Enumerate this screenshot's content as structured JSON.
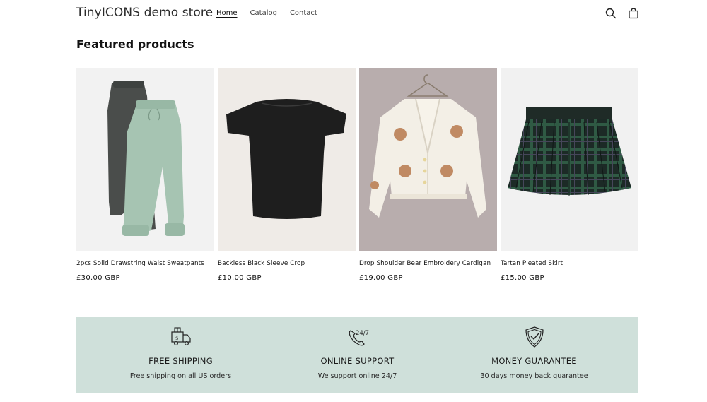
{
  "header": {
    "store_name": "TinyICONS demo store",
    "nav": [
      {
        "label": "Home",
        "active": true
      },
      {
        "label": "Catalog",
        "active": false
      },
      {
        "label": "Contact",
        "active": false
      }
    ],
    "icons": [
      "search-icon",
      "cart-icon"
    ]
  },
  "featured": {
    "title": "Featured products",
    "products": [
      {
        "name": "2pcs Solid Drawstring Waist Sweatpants",
        "price": "£30.00 GBP",
        "image": "sweatpants-image"
      },
      {
        "name": "Backless Black Sleeve Crop",
        "price": "£10.00 GBP",
        "image": "black-crop-top-image"
      },
      {
        "name": "Drop Shoulder Bear Embroidery Cardigan",
        "price": "£19.00 GBP",
        "image": "bear-cardigan-image"
      },
      {
        "name": "Tartan Pleated Skirt",
        "price": "£15.00 GBP",
        "image": "tartan-skirt-image"
      }
    ]
  },
  "features": {
    "background_color": "#cfe0da",
    "items": [
      {
        "icon": "shipping-truck-icon",
        "title": "FREE SHIPPING",
        "description": "Free shipping on all US orders"
      },
      {
        "icon": "phone-24-7-icon",
        "title": "ONLINE SUPPORT",
        "description": "We support online 24/7"
      },
      {
        "icon": "shield-check-icon",
        "title": "MONEY GUARANTEE",
        "description": "30 days money back guarantee"
      }
    ]
  }
}
